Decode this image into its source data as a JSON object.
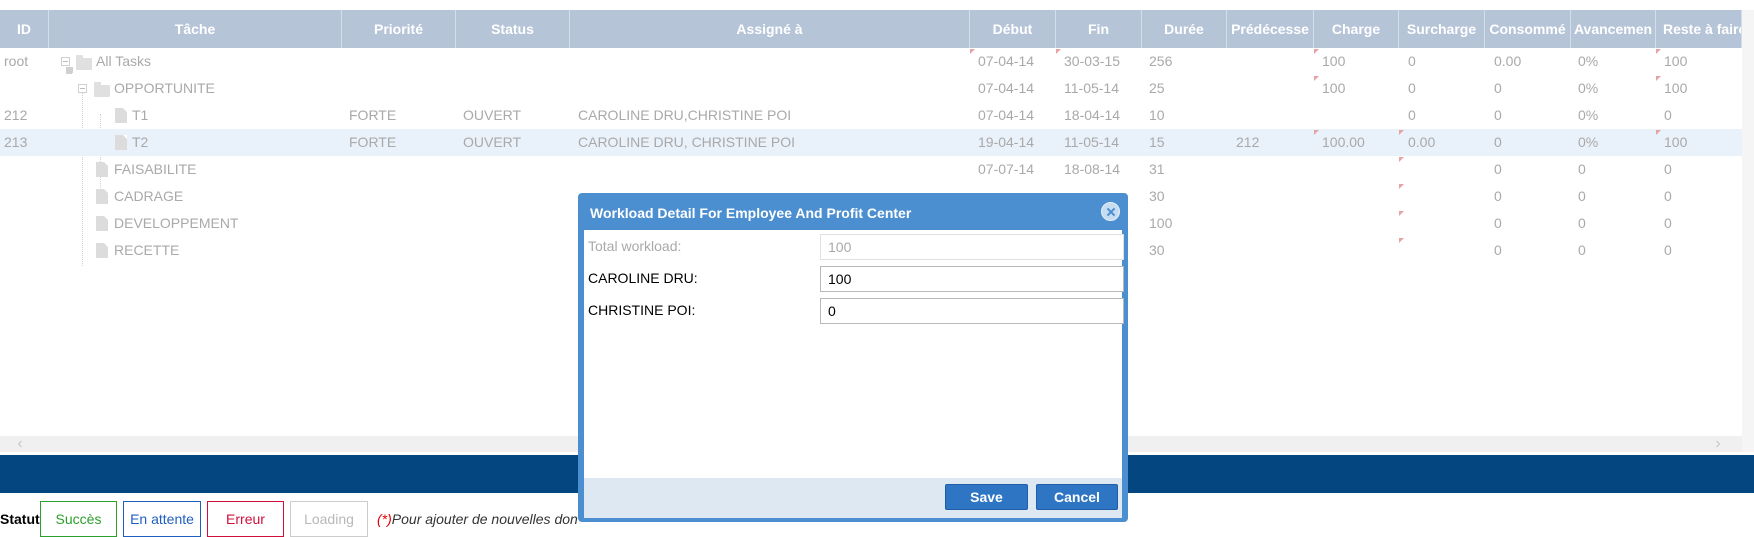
{
  "grid": {
    "columns": [
      "ID",
      "Tâche",
      "Priorité",
      "Status",
      "Assigné à",
      "Début",
      "Fin",
      "Durée",
      "Prédécesse",
      "Charge",
      "Surcharge",
      "Consommé",
      "Avancemen",
      "Reste à faire"
    ],
    "rows": [
      {
        "id": "root",
        "task": "All Tasks",
        "priority": "",
        "status": "",
        "assigned": "",
        "start": "07-04-14",
        "end": "30-03-15",
        "duration": "256",
        "pred": "",
        "charge": "100",
        "overload": "0",
        "consumed": "0.00",
        "progress": "0%",
        "remaining": "100"
      },
      {
        "id": "",
        "task": "OPPORTUNITE",
        "priority": "",
        "status": "",
        "assigned": "",
        "start": "07-04-14",
        "end": "11-05-14",
        "duration": "25",
        "pred": "",
        "charge": "100",
        "overload": "0",
        "consumed": "0",
        "progress": "0%",
        "remaining": "100"
      },
      {
        "id": "212",
        "task": "T1",
        "priority": "FORTE",
        "status": "OUVERT",
        "assigned": "CAROLINE DRU,CHRISTINE POI",
        "start": "07-04-14",
        "end": "18-04-14",
        "duration": "10",
        "pred": "",
        "charge": "",
        "overload": "0",
        "consumed": "0",
        "progress": "0%",
        "remaining": "0"
      },
      {
        "id": "213",
        "task": "T2",
        "priority": "FORTE",
        "status": "OUVERT",
        "assigned": "CAROLINE DRU, CHRISTINE POI",
        "start": "19-04-14",
        "end": "11-05-14",
        "duration": "15",
        "pred": "212",
        "charge": "100.00",
        "overload": "0.00",
        "consumed": "0",
        "progress": "0%",
        "remaining": "100"
      },
      {
        "id": "",
        "task": "FAISABILITE",
        "priority": "",
        "status": "",
        "assigned": "",
        "start": "07-07-14",
        "end": "18-08-14",
        "duration": "31",
        "pred": "",
        "charge": "",
        "overload": "",
        "consumed": "0",
        "progress": "0",
        "remaining": "0"
      },
      {
        "id": "",
        "task": "CADRAGE",
        "priority": "",
        "status": "",
        "assigned": "",
        "start": "",
        "end": "",
        "duration": "30",
        "pred": "",
        "charge": "",
        "overload": "",
        "consumed": "0",
        "progress": "0",
        "remaining": "0"
      },
      {
        "id": "",
        "task": "DEVELOPPEMENT",
        "priority": "",
        "status": "",
        "assigned": "",
        "start": "",
        "end": "",
        "duration": "100",
        "pred": "",
        "charge": "",
        "overload": "",
        "consumed": "0",
        "progress": "0",
        "remaining": "0"
      },
      {
        "id": "",
        "task": "RECETTE",
        "priority": "",
        "status": "",
        "assigned": "",
        "start": "",
        "end": "",
        "duration": "30",
        "pred": "",
        "charge": "",
        "overload": "",
        "consumed": "0",
        "progress": "0",
        "remaining": "0"
      }
    ]
  },
  "status_bar": {
    "label": "Statut",
    "buttons": [
      {
        "label": "Succès",
        "color": "#2ca02c"
      },
      {
        "label": "En attente",
        "color": "#1f5fbf"
      },
      {
        "label": "Erreur",
        "color": "#d0103a"
      },
      {
        "label": "Loading",
        "color": "#b8b8b8"
      }
    ],
    "note_required": "(*)",
    "note_text": "Pour ajouter de nouvelles don"
  },
  "modal": {
    "title": "Workload Detail For Employee And Profit Center",
    "total_label": "Total workload:",
    "total_value": "100",
    "fields": [
      {
        "label": "CAROLINE DRU:",
        "value": "100"
      },
      {
        "label": "CHRISTINE POI:",
        "value": "0"
      }
    ],
    "save_label": "Save",
    "cancel_label": "Cancel"
  },
  "colors": {
    "header_bg": "#b6c4d8",
    "brand_bar": "#04467f",
    "modal_frame": "#4b8fd0",
    "button_bg": "#2e75c4"
  },
  "icons": [
    "folder-icon",
    "document-icon",
    "collapse-icon",
    "close-icon",
    "scroll-left-icon",
    "scroll-right-icon"
  ]
}
